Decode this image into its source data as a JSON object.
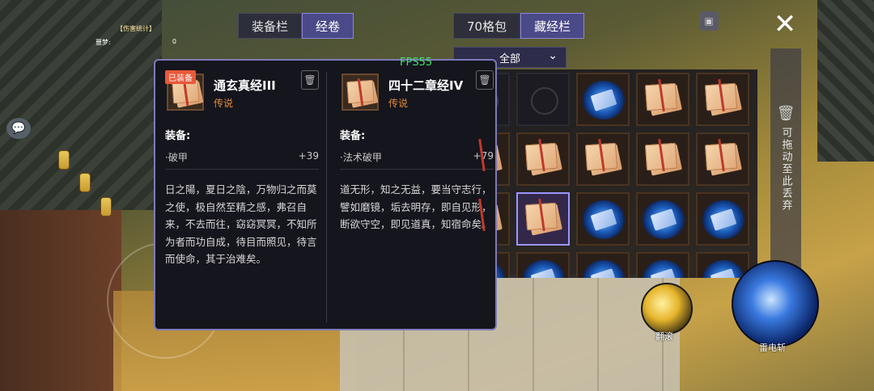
{
  "hud": {
    "stats_title": "【伤害统计】",
    "stats_row_label": "噩梦:",
    "stats_row_value": "0",
    "fps": "FPS55"
  },
  "tabs_left": [
    {
      "label": "装备栏",
      "active": false
    },
    {
      "label": "经卷",
      "active": true
    }
  ],
  "tabs_right": [
    {
      "label": "70格包",
      "active": false
    },
    {
      "label": "藏经栏",
      "active": true
    }
  ],
  "filter": {
    "selected": "全部"
  },
  "discard_hint": "可拖动至此丢弃",
  "grid": {
    "rows": [
      [
        "empty",
        "empty",
        "blue",
        "scroll",
        "scroll"
      ],
      [
        "scroll",
        "scroll",
        "scroll",
        "scroll",
        "scroll"
      ],
      [
        "scroll",
        "scroll-selected",
        "blue",
        "blue",
        "blue"
      ],
      [
        "blue",
        "blue",
        "blue",
        "blue",
        "blue"
      ]
    ]
  },
  "tooltip": {
    "equipped": {
      "badge": "已装备",
      "name": "通玄真经III",
      "rarity": "传说",
      "section": "装备:",
      "stat_name": "·破甲",
      "stat_value": "+39",
      "desc": "日之陽，夏日之陰，万物归之而莫之使，极自然至精之感，弗召自来，不去而往，窈窈冥冥，不知所为者而功自成，待目而照见，待言而使命，其于治难矣。"
    },
    "compare": {
      "name": "四十二章经IV",
      "rarity": "传说",
      "section": "装备:",
      "stat_name": "·法术破甲",
      "stat_value": "+79",
      "desc": "道无形，知之无益，要当守志行，譬如磨镜，垢去明存，即自见形，断欲守空，即见道真，知宿命矣。"
    }
  },
  "skills": {
    "skill_1": "翻滚",
    "skill_2": "雷电斩"
  },
  "colors": {
    "accent": "#7d7bb8",
    "rarity": "#e48c3a",
    "badge": "#e8593a",
    "fps": "#3fe36a"
  }
}
